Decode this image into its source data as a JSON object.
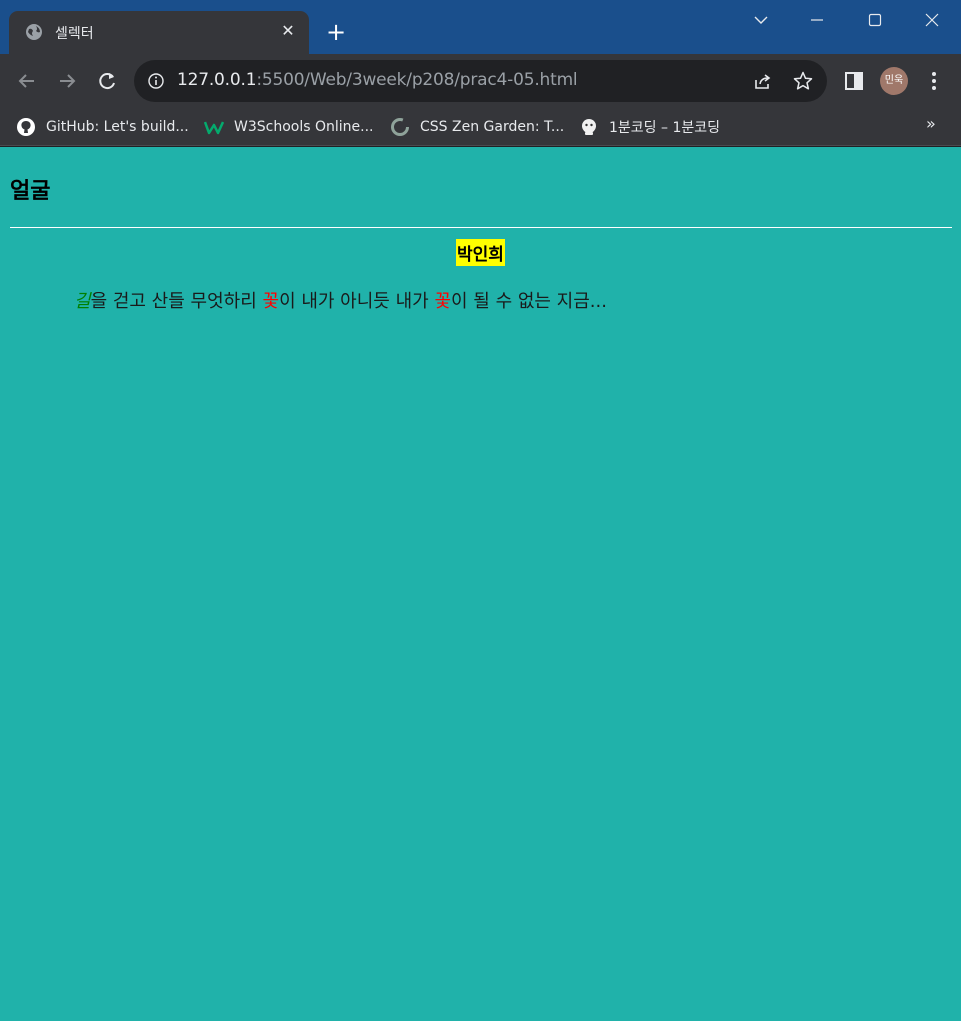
{
  "browser": {
    "tab": {
      "title": "셀렉터",
      "favicon": "globe-icon"
    },
    "address": {
      "host": "127.0.0.1",
      "path": ":5500/Web/3week/p208/prac4-05.html"
    },
    "profile_initials": "민욱",
    "bookmarks": [
      {
        "label": "GitHub: Let's build...",
        "icon": "github-icon"
      },
      {
        "label": "W3Schools Online...",
        "icon": "w3schools-icon"
      },
      {
        "label": "CSS Zen Garden: T...",
        "icon": "css-zen-garden-icon"
      },
      {
        "label": "1분코딩 – 1분코딩",
        "icon": "1min-coding-icon"
      }
    ],
    "more_bookmarks": "»"
  },
  "page": {
    "heading": "얼굴",
    "author": "박인희",
    "poem": {
      "w1": "길",
      "t1": "을 걷고 산들 무엇하리 ",
      "w2": "꽃",
      "t2": "이 내가 아니듯 내가 ",
      "w3": "꽃",
      "t3": "이 될 수 없는 지금..."
    }
  },
  "colors": {
    "titlebar": "#1a4f8c",
    "page_background": "#20b2aa",
    "highlight": "#ffff00",
    "accent_green": "#008000",
    "accent_red": "#ff0000"
  }
}
